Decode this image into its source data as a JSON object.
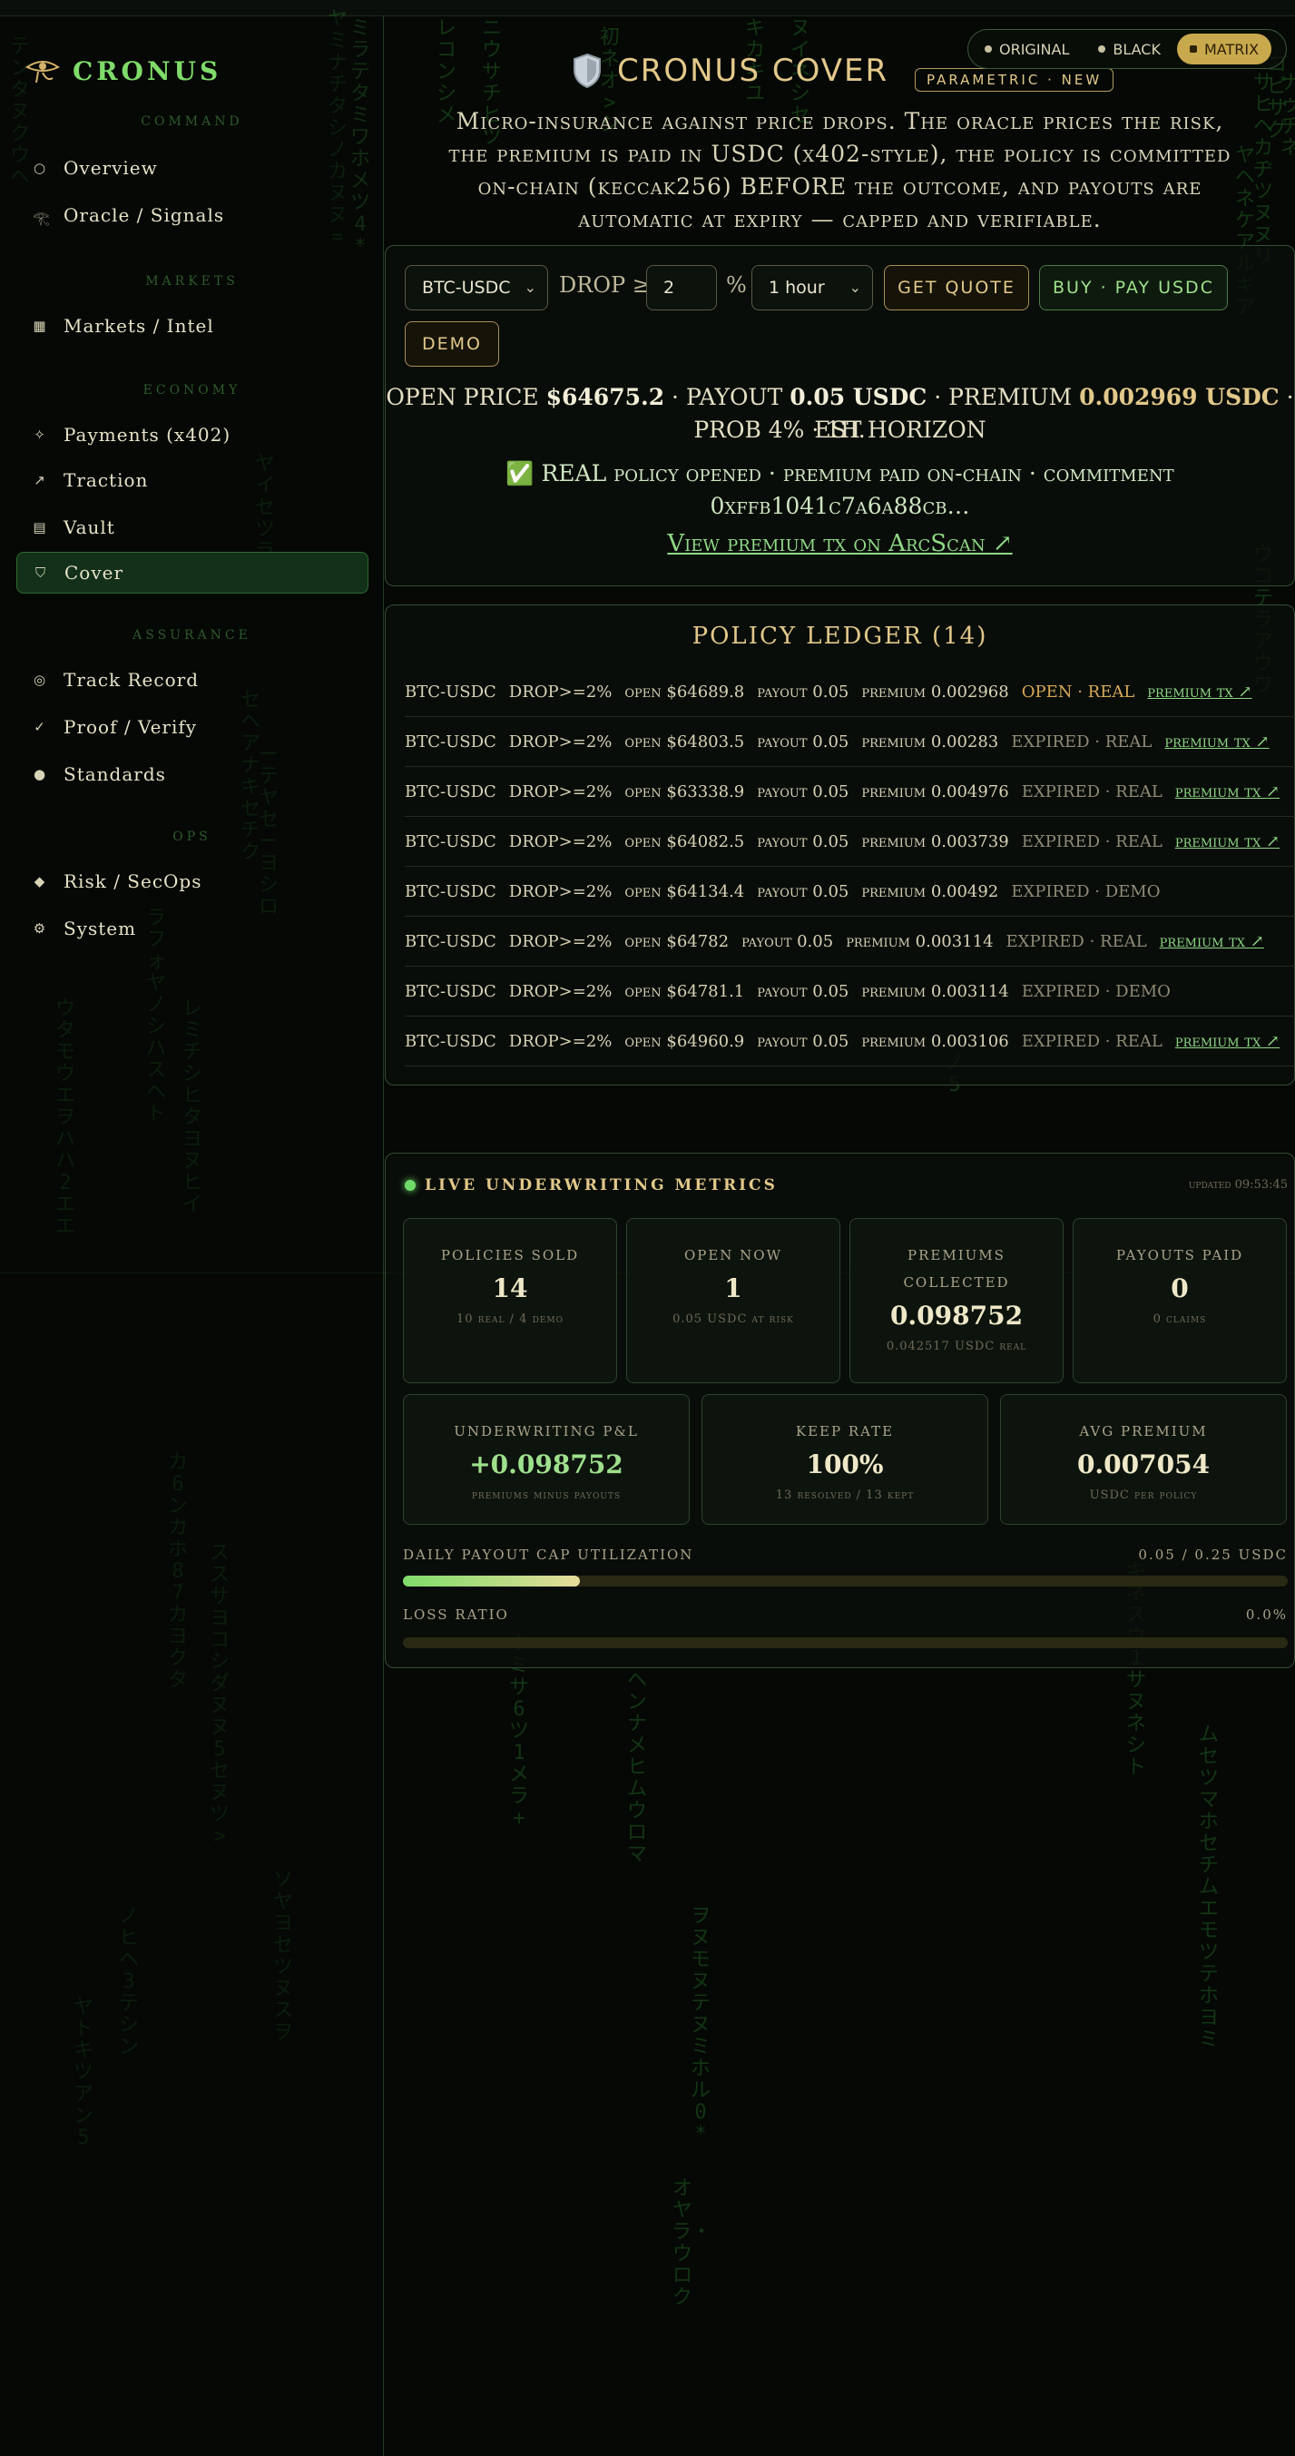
{
  "brand": {
    "name": "CRONUS"
  },
  "sidebar": {
    "sections": [
      {
        "label": "COMMAND",
        "items": [
          {
            "label": "Overview",
            "icon": "circle-outline-icon"
          },
          {
            "label": "Oracle / Signals",
            "icon": "eye-of-horus-icon"
          }
        ]
      },
      {
        "label": "MARKETS",
        "items": [
          {
            "label": "Markets / Intel",
            "icon": "grid-icon"
          }
        ]
      },
      {
        "label": "ECONOMY",
        "items": [
          {
            "label": "Payments (x402)",
            "icon": "sparkle-icon"
          },
          {
            "label": "Traction",
            "icon": "arrow-up-right-icon"
          },
          {
            "label": "Vault",
            "icon": "vault-icon"
          },
          {
            "label": "Cover",
            "icon": "shield-icon",
            "active": true
          }
        ]
      },
      {
        "label": "ASSURANCE",
        "items": [
          {
            "label": "Track Record",
            "icon": "target-icon"
          },
          {
            "label": "Proof / Verify",
            "icon": "check-icon"
          },
          {
            "label": "Standards",
            "icon": "dot-icon"
          }
        ]
      },
      {
        "label": "OPS",
        "items": [
          {
            "label": "Risk / SecOps",
            "icon": "diamond-icon"
          },
          {
            "label": "System",
            "icon": "gear-icon"
          }
        ]
      }
    ]
  },
  "header": {
    "title": "CRONUS COVER",
    "badge": "PARAMETRIC · NEW",
    "themes": [
      "ORIGINAL",
      "BLACK",
      "MATRIX"
    ],
    "active_theme": "MATRIX",
    "description_line1": "Micro-insurance against price drops. The oracle prices the risk,",
    "description_line2": "the premium is paid in USDC (x402-style), the policy is committed",
    "description_line3": "on-chain (keccak256) BEFORE the outcome, and payouts are",
    "description_line4": "automatic at expiry — capped and verifiable."
  },
  "quote_form": {
    "pair": "BTC-USDC",
    "drop_label": "DROP ≥",
    "drop_value": "2",
    "percent": "%",
    "horizon": "1 hour",
    "get_quote": "GET QUOTE",
    "buy": "BUY · PAY USDC",
    "demo": "DEMO"
  },
  "quote_result": {
    "open_price_label": "OPEN PRICE",
    "open_price": "$64675.2",
    "payout_label": "· PAYOUT",
    "payout": "0.05 USDC",
    "premium_label": "· PREMIUM",
    "premium": "0.002969 USDC",
    "rest_line1": "· EST.",
    "rest_line2": "PROB 4% · 1H HORIZON",
    "policy_line1": "✅ REAL policy opened · premium paid on-chain · commitment",
    "policy_line2": "0xffb1041c7a6a88cb…",
    "tx_link": "View premium tx on ArcScan ↗"
  },
  "ledger": {
    "title": "POLICY LEDGER (14)",
    "rows": [
      {
        "pair": "BTC-USDC",
        "drop": "DROP>=2%",
        "open": "open $64689.8",
        "payout": "payout 0.05",
        "premium": "premium 0.002968",
        "status": "OPEN · REAL",
        "state": "open",
        "link": "premium tx ↗"
      },
      {
        "pair": "BTC-USDC",
        "drop": "DROP>=2%",
        "open": "open $64803.5",
        "payout": "payout 0.05",
        "premium": "premium 0.00283",
        "status": "EXPIRED · REAL",
        "state": "expired",
        "link": "premium tx ↗"
      },
      {
        "pair": "BTC-USDC",
        "drop": "DROP>=2%",
        "open": "open $63338.9",
        "payout": "payout 0.05",
        "premium": "premium 0.004976",
        "status": "EXPIRED · REAL",
        "state": "expired",
        "link": "premium tx ↗"
      },
      {
        "pair": "BTC-USDC",
        "drop": "DROP>=2%",
        "open": "open $64082.5",
        "payout": "payout 0.05",
        "premium": "premium 0.003739",
        "status": "EXPIRED · REAL",
        "state": "expired",
        "link": "premium tx ↗"
      },
      {
        "pair": "BTC-USDC",
        "drop": "DROP>=2%",
        "open": "open $64134.4",
        "payout": "payout 0.05",
        "premium": "premium 0.00492",
        "status": "EXPIRED · DEMO",
        "state": "expired",
        "link": ""
      },
      {
        "pair": "BTC-USDC",
        "drop": "DROP>=2%",
        "open": "open $64782",
        "payout": "payout 0.05",
        "premium": "premium 0.003114",
        "status": "EXPIRED · REAL",
        "state": "expired",
        "link": "premium tx ↗"
      },
      {
        "pair": "BTC-USDC",
        "drop": "DROP>=2%",
        "open": "open $64781.1",
        "payout": "payout 0.05",
        "premium": "premium 0.003114",
        "status": "EXPIRED · DEMO",
        "state": "expired",
        "link": ""
      },
      {
        "pair": "BTC-USDC",
        "drop": "DROP>=2%",
        "open": "open $64960.9",
        "payout": "payout 0.05",
        "premium": "premium 0.003106",
        "status": "EXPIRED · REAL",
        "state": "expired",
        "link": "premium tx ↗"
      }
    ]
  },
  "metrics": {
    "title": "LIVE UNDERWRITING METRICS",
    "updated": "updated 09:53:45",
    "cards_top": [
      {
        "label": "POLICIES SOLD",
        "label2": "",
        "value": "14",
        "sub": "10 real / 4 demo"
      },
      {
        "label": "OPEN NOW",
        "label2": "",
        "value": "1",
        "sub": "0.05 USDC at risk"
      },
      {
        "label": "PREMIUMS",
        "label2": "COLLECTED",
        "value": "0.098752",
        "sub": "0.042517 USDC real"
      },
      {
        "label": "PAYOUTS PAID",
        "label2": "",
        "value": "0",
        "sub": "0 claims"
      }
    ],
    "cards_bottom": [
      {
        "label": "UNDERWRITING P&L",
        "value": "+0.098752",
        "sub": "premiums minus payouts"
      },
      {
        "label": "KEEP RATE",
        "value": "100%",
        "sub": "13 resolved / 13 kept"
      },
      {
        "label": "AVG PREMIUM",
        "value": "0.007054",
        "sub": "USDC per policy"
      }
    ],
    "payout_cap_label": "DAILY PAYOUT CAP UTILIZATION",
    "payout_cap_value": "0.05 / 0.25 USDC",
    "payout_cap_fraction": 0.2,
    "loss_ratio_label": "LOSS RATIO",
    "loss_ratio_value": "0.0%",
    "loss_ratio_fraction": 0.0
  },
  "colors": {
    "accent_green": "#7fdc6a",
    "gold": "#e2c88a",
    "background": "#050805"
  }
}
